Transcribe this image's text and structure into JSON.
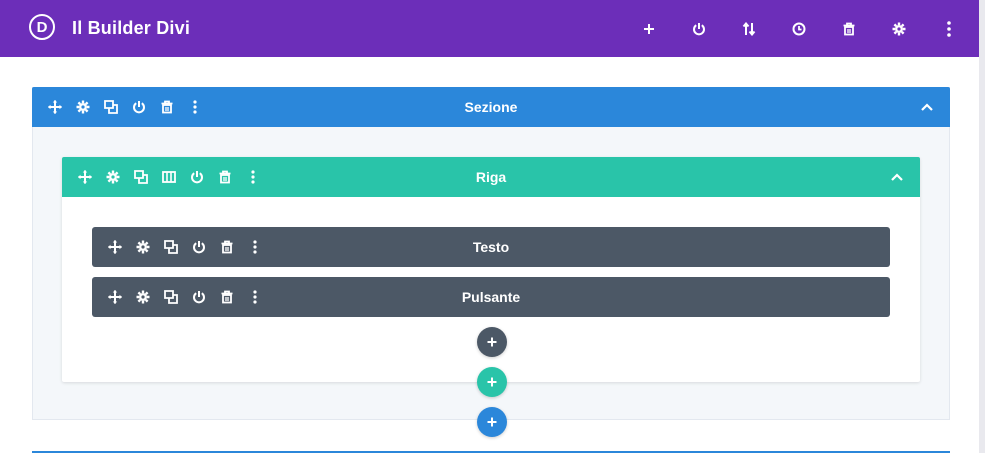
{
  "app": {
    "logo_letter": "D",
    "title": "Il Builder Divi"
  },
  "topbar": {
    "icons": [
      "plus-icon",
      "power-icon",
      "sort-icon",
      "history-icon",
      "trash-icon",
      "gear-icon",
      "more-vertical-icon"
    ]
  },
  "section": {
    "label": "Sezione",
    "icons": [
      "move-icon",
      "gear-icon",
      "duplicate-icon",
      "power-icon",
      "trash-icon",
      "more-vertical-icon"
    ]
  },
  "row": {
    "label": "Riga",
    "icons": [
      "move-icon",
      "gear-icon",
      "duplicate-icon",
      "columns-icon",
      "power-icon",
      "trash-icon",
      "more-vertical-icon"
    ]
  },
  "modules": [
    {
      "label": "Testo"
    },
    {
      "label": "Pulsante"
    }
  ],
  "colors": {
    "topbar": "#6c2eb9",
    "section": "#2b87da",
    "row": "#29c4a9",
    "module": "#4c5866"
  }
}
